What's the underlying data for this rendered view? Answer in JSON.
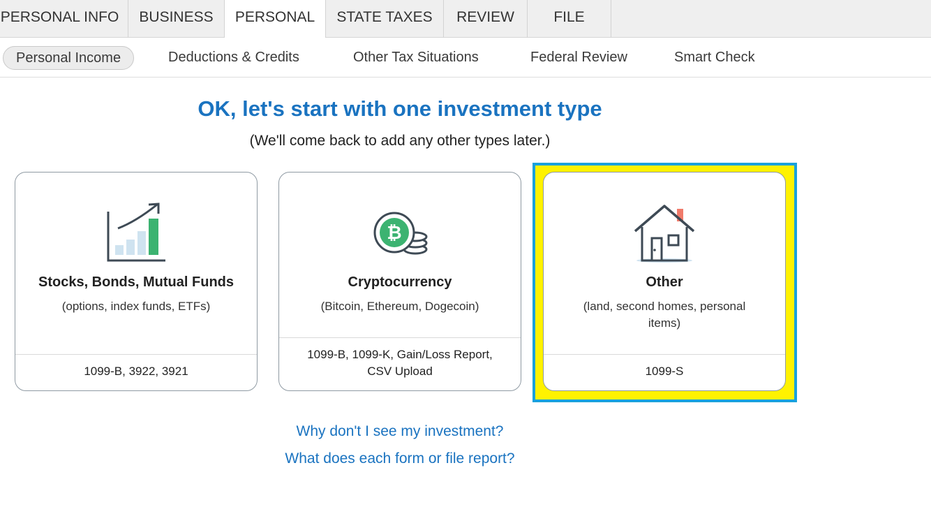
{
  "top_tabs": [
    {
      "label": "PERSONAL INFO",
      "active": false
    },
    {
      "label": "BUSINESS",
      "active": false
    },
    {
      "label": "PERSONAL",
      "active": true
    },
    {
      "label": "STATE TAXES",
      "active": false
    },
    {
      "label": "REVIEW",
      "active": false
    },
    {
      "label": "FILE",
      "active": false
    }
  ],
  "sub_tabs": [
    {
      "label": "Personal Income",
      "active": true
    },
    {
      "label": "Deductions & Credits",
      "active": false
    },
    {
      "label": "Other Tax Situations",
      "active": false
    },
    {
      "label": "Federal Review",
      "active": false
    },
    {
      "label": "Smart Check",
      "active": false
    }
  ],
  "heading": {
    "title": "OK, let's start with one investment type",
    "subtitle": "(We'll come back to add any other types later.)"
  },
  "cards": [
    {
      "icon": "stocks-chart-icon",
      "title": "Stocks, Bonds, Mutual Funds",
      "description": "(options, index funds, ETFs)",
      "forms": "1099-B, 3922, 3921",
      "selected": false
    },
    {
      "icon": "bitcoin-coins-icon",
      "title": "Cryptocurrency",
      "description": "(Bitcoin, Ethereum, Dogecoin)",
      "forms": "1099-B, 1099-K, Gain/Loss Report, CSV Upload",
      "selected": false
    },
    {
      "icon": "house-icon",
      "title": "Other",
      "description": "(land, second homes, personal items)",
      "forms": "1099-S",
      "selected": true
    }
  ],
  "links": {
    "why_not_see": "Why don't I see my investment?",
    "what_form": "What does each form or file report?"
  },
  "colors": {
    "link_blue": "#1a73c0",
    "highlight_yellow": "#fff200",
    "highlight_border": "#1aa1dc",
    "bar_green": "#3cb371",
    "bar_light_blue": "#cfe3f0",
    "roof_red": "#f07a6a"
  }
}
